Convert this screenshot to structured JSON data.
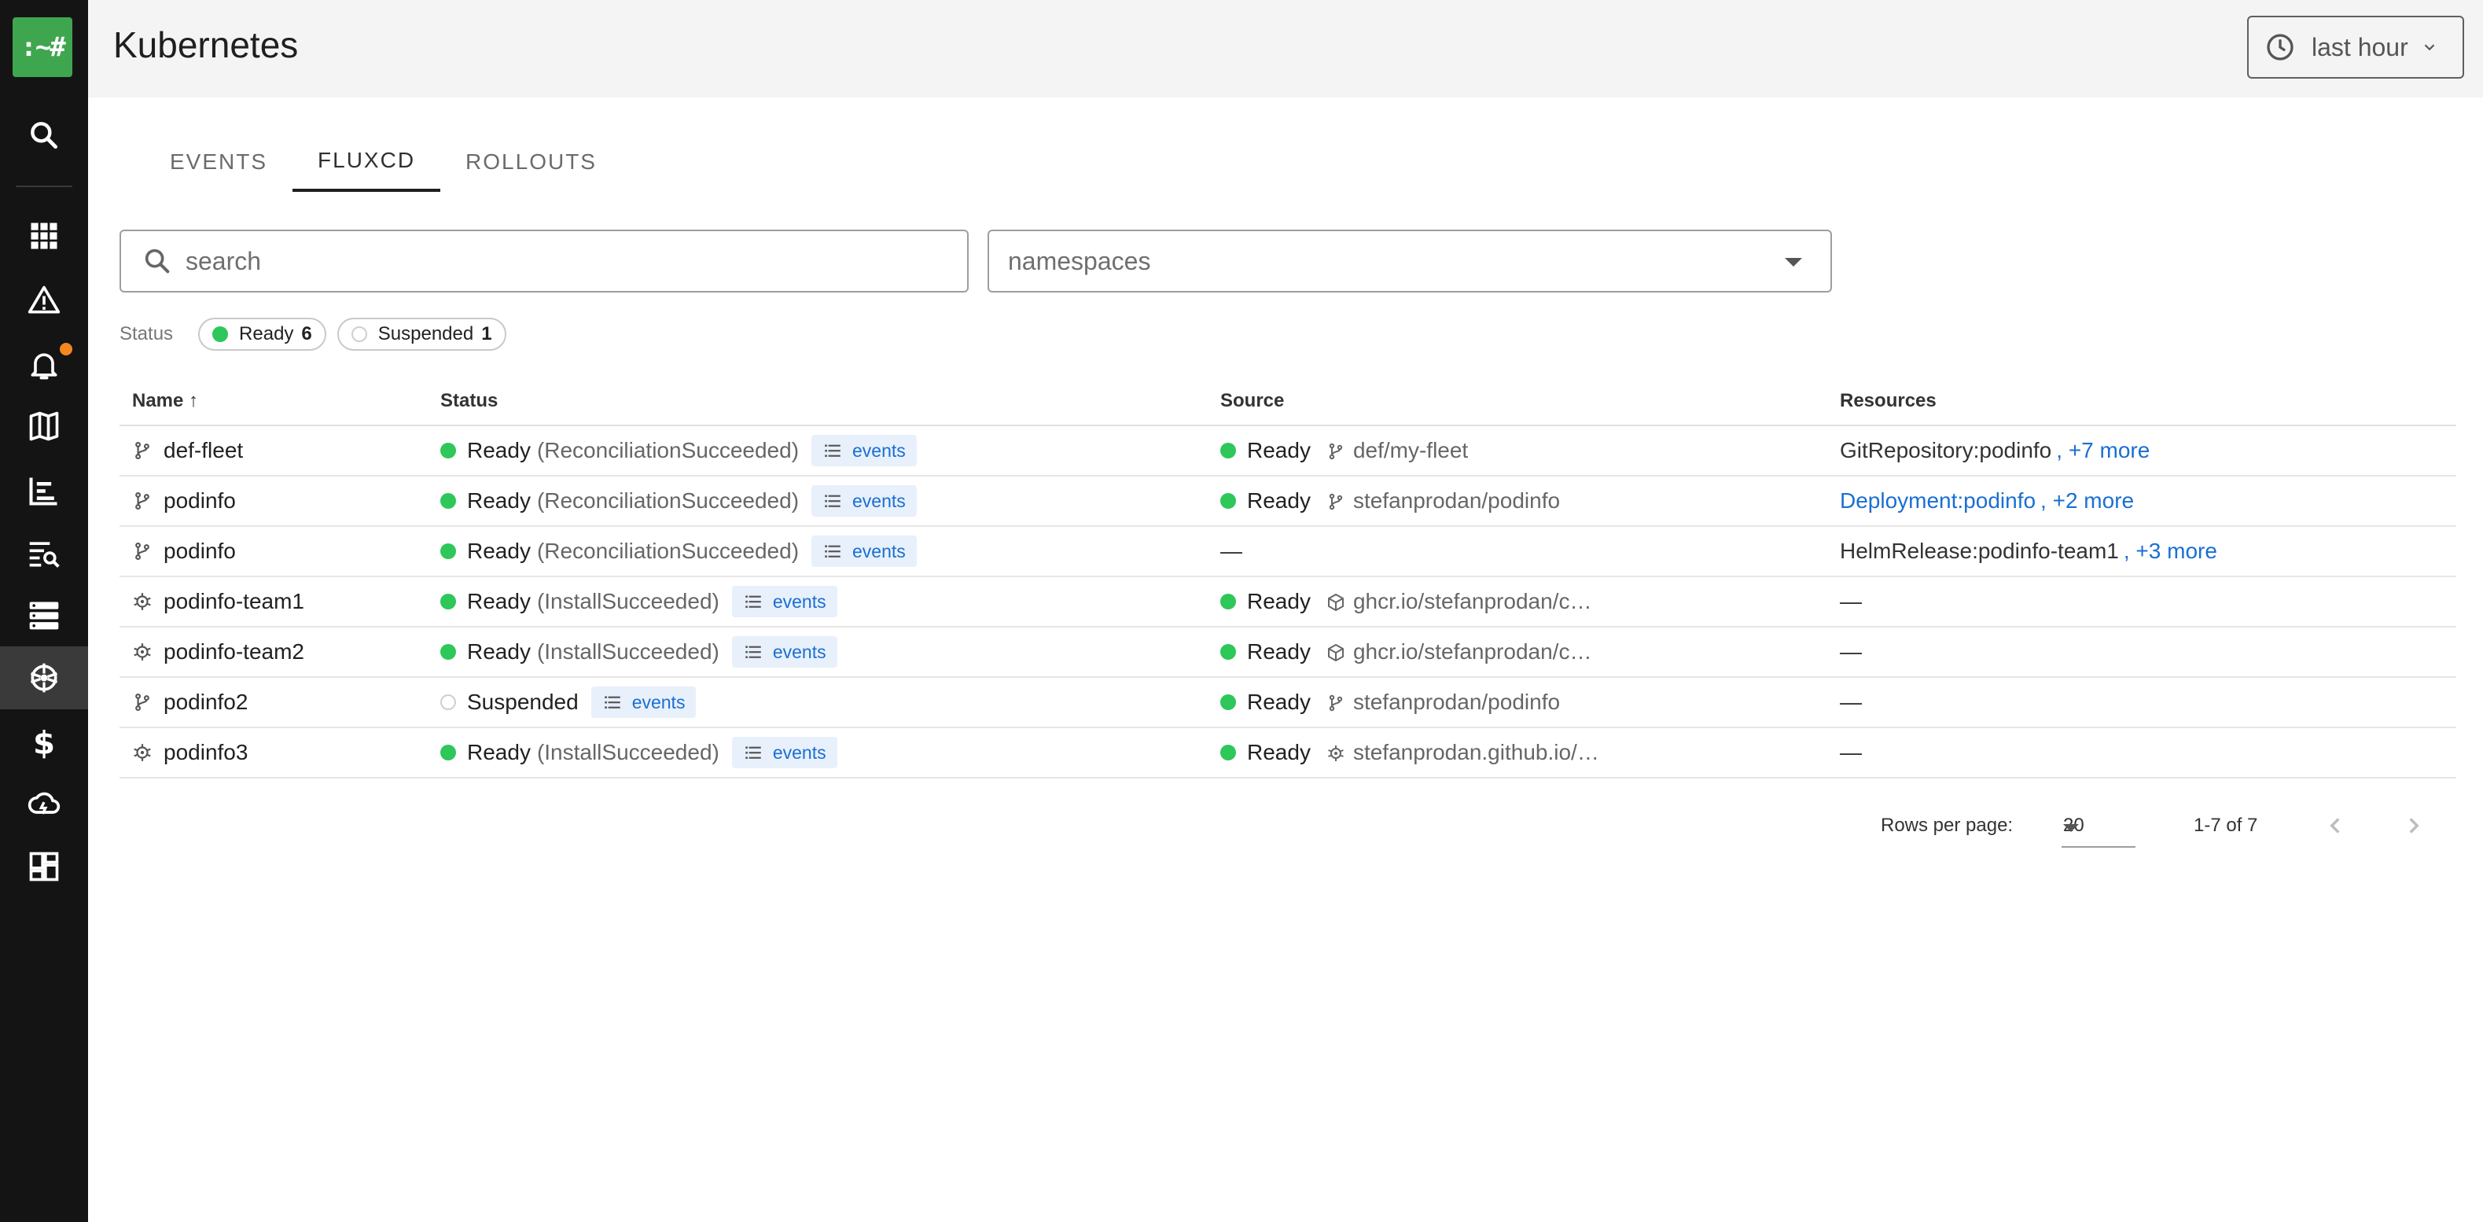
{
  "app": {
    "logo_text": ":~#",
    "title": "Kubernetes",
    "accent_color": "#3fa650",
    "notification_color": "#f5871f"
  },
  "time_range": {
    "label": "last hour",
    "icon": "clock-icon"
  },
  "sidebar": {
    "items": [
      {
        "icon": "search-icon"
      },
      {
        "icon": "apps-grid-icon"
      },
      {
        "icon": "warning-icon"
      },
      {
        "icon": "bell-icon"
      },
      {
        "icon": "map-icon"
      },
      {
        "icon": "chart-icon"
      },
      {
        "icon": "log-search-icon"
      },
      {
        "icon": "servers-icon"
      },
      {
        "icon": "kubernetes-icon",
        "active": true
      },
      {
        "icon": "dollar-icon"
      },
      {
        "icon": "cloud-icon"
      },
      {
        "icon": "dashboard-icon"
      }
    ]
  },
  "tabs": [
    {
      "label": "EVENTS"
    },
    {
      "label": "FLUXCD",
      "active": true
    },
    {
      "label": "ROLLOUTS"
    }
  ],
  "filters": {
    "search_placeholder": "search",
    "namespaces_placeholder": "namespaces",
    "status_label": "Status",
    "chips": [
      {
        "label": "Ready",
        "count": "6",
        "color": "#2ec75a"
      },
      {
        "label": "Suspended",
        "count": "1",
        "color": "#ffffff"
      }
    ]
  },
  "table": {
    "columns": {
      "name": "Name",
      "status": "Status",
      "source": "Source",
      "resources": "Resources"
    },
    "sort_indicator": "↑",
    "rows": [
      {
        "kind": "kustomization",
        "name": "def-fleet",
        "status": "Ready",
        "reason": "(ReconciliationSucceeded)",
        "events": "events",
        "source_status": "Ready",
        "source_kind": "git",
        "source": "def/my-fleet",
        "res_main": "GitRepository:podinfo",
        "res_main_link": false,
        "res_more": ", +7 more"
      },
      {
        "kind": "kustomization",
        "name": "podinfo",
        "status": "Ready",
        "reason": "(ReconciliationSucceeded)",
        "events": "events",
        "source_status": "Ready",
        "source_kind": "git",
        "source": "stefanprodan/podinfo",
        "res_main": "Deployment:podinfo",
        "res_main_link": true,
        "res_more": ", +2 more"
      },
      {
        "kind": "kustomization",
        "name": "podinfo",
        "status": "Ready",
        "reason": "(ReconciliationSucceeded)",
        "events": "events",
        "source_status": "",
        "source_kind": "",
        "source": "—",
        "res_main": "HelmRelease:podinfo-team1",
        "res_main_link": false,
        "res_more": ", +3 more"
      },
      {
        "kind": "helm",
        "name": "podinfo-team1",
        "status": "Ready",
        "reason": "(InstallSucceeded)",
        "events": "events",
        "source_status": "Ready",
        "source_kind": "oci",
        "source": "ghcr.io/stefanprodan/c…",
        "res_main": "—",
        "res_main_link": false,
        "res_more": ""
      },
      {
        "kind": "helm",
        "name": "podinfo-team2",
        "status": "Ready",
        "reason": "(InstallSucceeded)",
        "events": "events",
        "source_status": "Ready",
        "source_kind": "oci",
        "source": "ghcr.io/stefanprodan/c…",
        "res_main": "—",
        "res_main_link": false,
        "res_more": ""
      },
      {
        "kind": "kustomization",
        "name": "podinfo2",
        "status": "Suspended",
        "reason": "",
        "events": "events",
        "source_status": "Ready",
        "source_kind": "git",
        "source": "stefanprodan/podinfo",
        "res_main": "—",
        "res_main_link": false,
        "res_more": ""
      },
      {
        "kind": "helm",
        "name": "podinfo3",
        "status": "Ready",
        "reason": "(InstallSucceeded)",
        "events": "events",
        "source_status": "Ready",
        "source_kind": "helm",
        "source": "stefanprodan.github.io/…",
        "res_main": "—",
        "res_main_link": false,
        "res_more": ""
      }
    ]
  },
  "pagination": {
    "rows_per_page_label": "Rows per page:",
    "rows_per_page": "20",
    "range": "1-7 of 7"
  },
  "colors": {
    "ready": "#2ec75a",
    "link": "#1a6fd1",
    "events_bg": "#e8f0fb"
  }
}
